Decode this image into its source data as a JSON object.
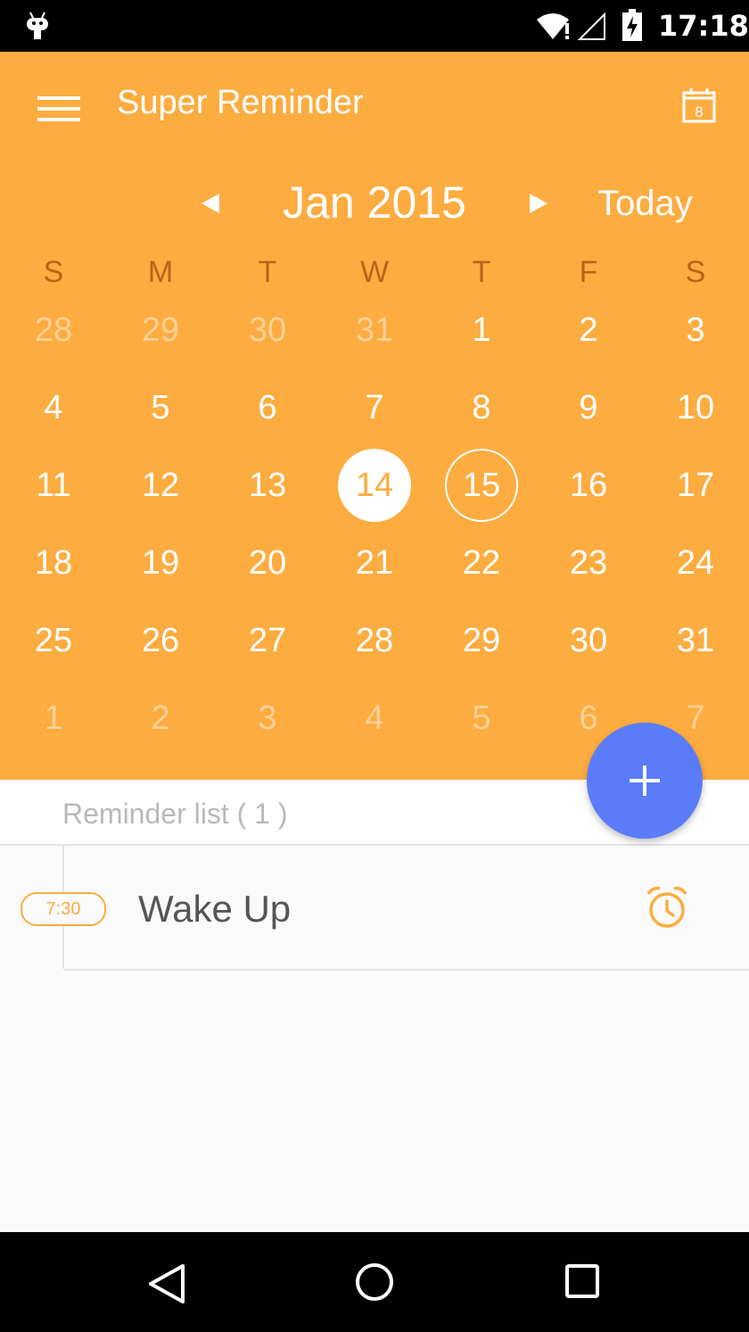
{
  "status_bar": {
    "time": "17:18"
  },
  "app_bar": {
    "title": "Super Reminder",
    "calendar_icon_day": "8"
  },
  "calendar": {
    "month_label": "Jan 2015",
    "today_label": "Today",
    "weekdays": [
      "S",
      "M",
      "T",
      "W",
      "T",
      "F",
      "S"
    ],
    "weeks": [
      [
        "28",
        "29",
        "30",
        "31",
        "1",
        "2",
        "3"
      ],
      [
        "4",
        "5",
        "6",
        "7",
        "8",
        "9",
        "10"
      ],
      [
        "11",
        "12",
        "13",
        "14",
        "15",
        "16",
        "17"
      ],
      [
        "18",
        "19",
        "20",
        "21",
        "22",
        "23",
        "24"
      ],
      [
        "25",
        "26",
        "27",
        "28",
        "29",
        "30",
        "31"
      ],
      [
        "1",
        "2",
        "3",
        "4",
        "5",
        "6",
        "7"
      ]
    ],
    "selected_day": "14",
    "today_day": "15"
  },
  "reminder_list": {
    "title": "Reminder list ( 1 )",
    "items": [
      {
        "time": "7:30",
        "title": "Wake Up"
      }
    ]
  },
  "colors": {
    "accent": "#fdac40",
    "fab": "#5a7cf9"
  }
}
